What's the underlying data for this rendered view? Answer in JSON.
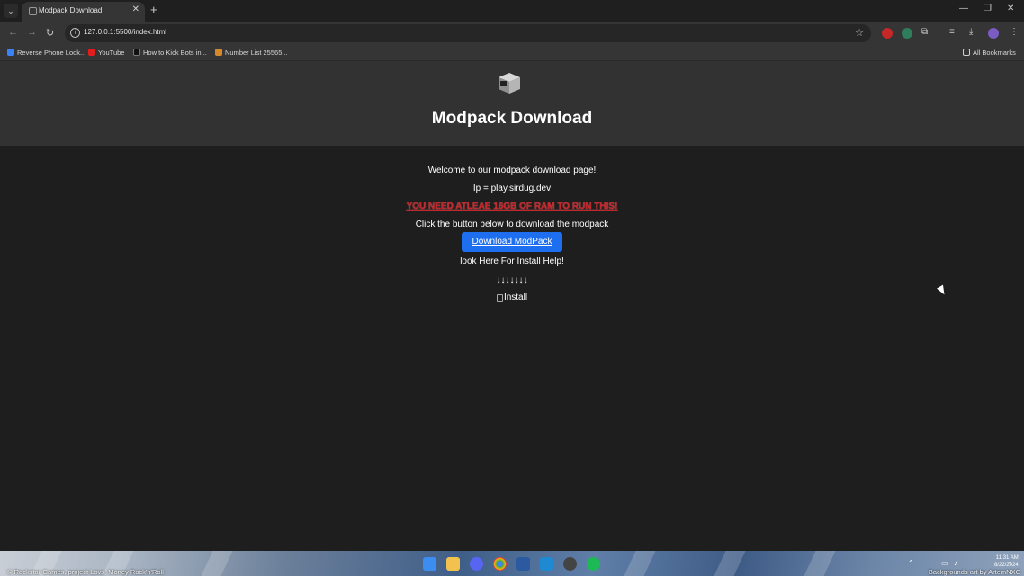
{
  "browser": {
    "tab_title": "Modpack Download",
    "url": "127.0.0.1:5500/index.html",
    "bookmarks": [
      {
        "label": "Reverse Phone Look...",
        "color": "#3b82f6"
      },
      {
        "label": "YouTube",
        "color": "#e11d1d"
      },
      {
        "label": "How to Kick Bots in...",
        "color": "#111111"
      },
      {
        "label": "Number List 25565...",
        "color": "#d48a2a"
      }
    ],
    "all_bookmarks": "All Bookmarks"
  },
  "page": {
    "title": "Modpack Download",
    "welcome": "Welcome to our modpack download page!",
    "ip": "Ip = play.sirdug.dev",
    "warning": "YOU NEED ATLEAE 16GB OF RAM TO RUN THIS!",
    "instruction": "Click the button below to download the modpack",
    "download_button": "Download ModPack",
    "install_help": "look Here For Install Help!",
    "arrows": "↓↓↓↓↓↓↓",
    "install_image_alt": "Install"
  },
  "taskbar": {
    "wallpaper_text": "© Rockstar Games, project Lovs, Money Rock'n'Roll",
    "wallpaper_credit": "Backgrounds art by ArtemNXC",
    "time": "11:31 AM",
    "date": "8/22/2024"
  }
}
